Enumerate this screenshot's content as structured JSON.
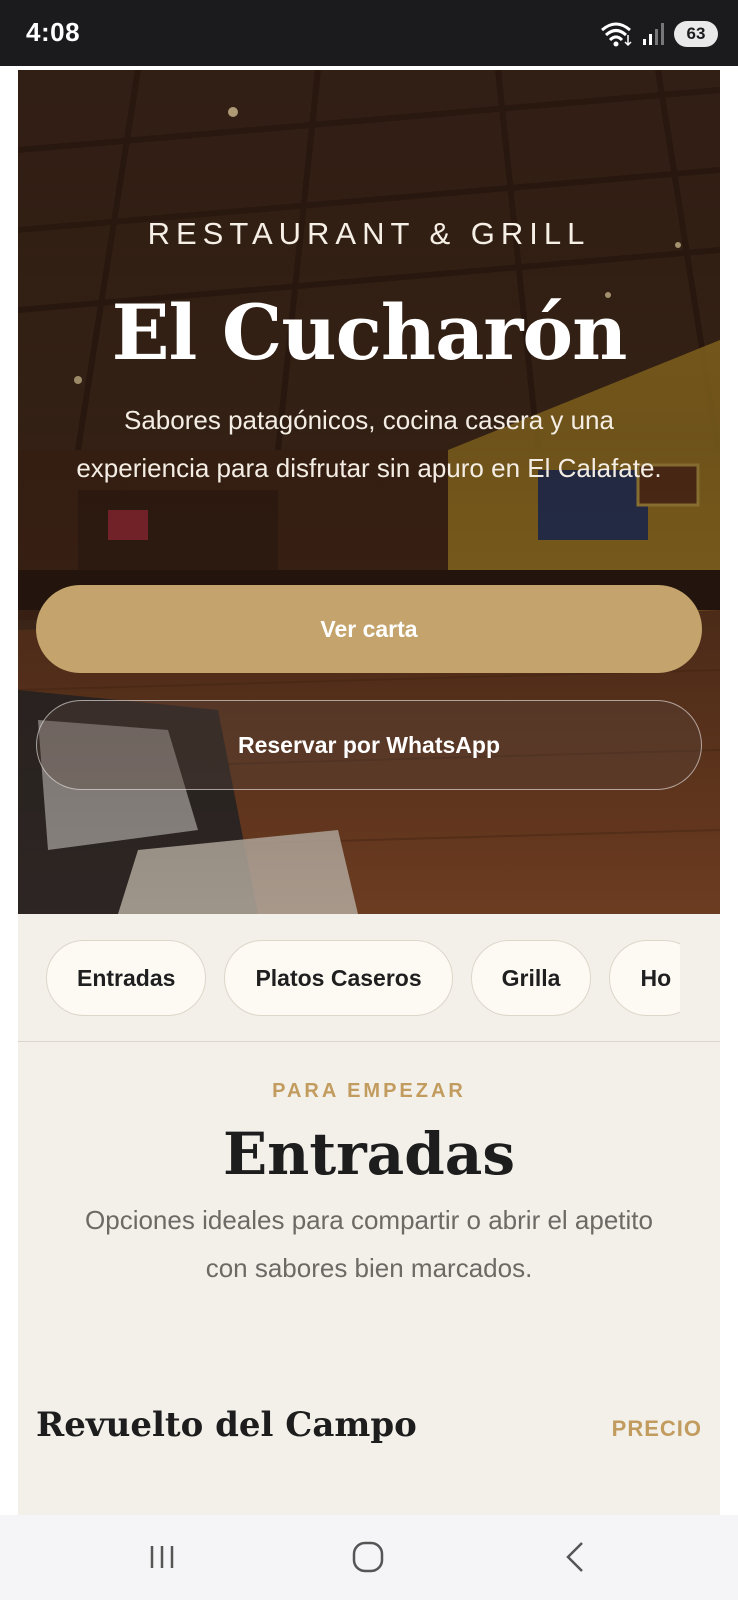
{
  "status_bar": {
    "time": "4:08",
    "battery": "63"
  },
  "hero": {
    "eyebrow": "RESTAURANT & GRILL",
    "title": "El Cucharón",
    "description": "Sabores patagónicos, cocina casera y una experiencia para disfrutar sin apuro en El Calafate.",
    "primary_button": "Ver carta",
    "secondary_button": "Reservar por WhatsApp"
  },
  "categories": [
    "Entradas",
    "Platos Caseros",
    "Grilla",
    "Ho"
  ],
  "section": {
    "eyebrow": "PARA EMPEZAR",
    "title": "Entradas",
    "description": "Opciones ideales para compartir o abrir el apetito con sabores bien marcados."
  },
  "menu_item": {
    "title": "Revuelto del Campo",
    "price_label": "PRECIO"
  },
  "colors": {
    "accent": "#c4a46c",
    "accent_text": "#c29c5f",
    "background": "#f3f0ea"
  }
}
